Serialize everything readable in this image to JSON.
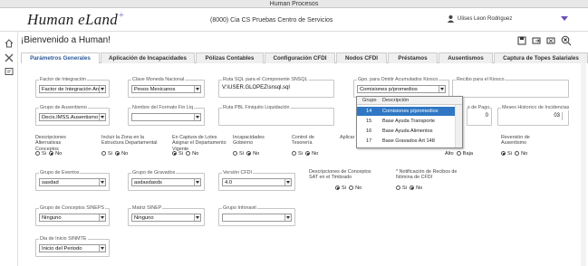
{
  "window_title": "Human Procesos",
  "header": {
    "logo_text": "Human eLand",
    "logo_mark": "+",
    "company": "(8000) Cia  CS  Pruebas Centro de Servicios",
    "user": "Ulises Leon Rodriguez"
  },
  "welcome": "¡Bienvenido a Human!",
  "tabs": [
    "Parámetros Generales",
    "Aplicación de Incapacidades",
    "Pólizas Contables",
    "Configuración CFDI",
    "Nodos CFDI",
    "Préstamos",
    "Ausentismos",
    "Captura de Topes Salariales"
  ],
  "fields": {
    "factor_integracion": {
      "label": "Factor de Integración",
      "value": "Factor de Integración Anu"
    },
    "clave_moneda": {
      "label": "Clave Moneda Nacional",
      "value": "Pesos Mexicanos"
    },
    "ruta_sql": {
      "label": "Ruta SQL para el Componente SNSQL",
      "value": "V:\\USER.GLOPEZ\\snsql.sql"
    },
    "grupo_omitir": {
      "label": "Gpo. para Omitir Acumulados Kiosco",
      "value": "Comisiones p/promedios"
    },
    "recibo_kiosco": {
      "label": "Recibo para el Kiosco",
      "value": ""
    },
    "grupo_ausentismo": {
      "label": "Grupo de Ausentismo",
      "value": "Decis.IMSS.Ausentismo"
    },
    "nombre_formato": {
      "label": "Nombre del Formato Fin Liq",
      "value": ""
    },
    "ruta_pbl": {
      "label": "Ruta PBL Finiquito Liquidación",
      "value": ""
    },
    "dias_pago": {
      "label": "s de Pago",
      "value": "0"
    },
    "meses_historico": {
      "label": "Meses Historico de Incidencias",
      "value": "03"
    },
    "grupo_eventos": {
      "label": "Grupo de Eventos",
      "value": "sasdad"
    },
    "grupo_gravados": {
      "label": "Grupo de Gravados",
      "value": "asdasdasds"
    },
    "version_cfdi": {
      "label": "Versión CFDI",
      "value": "4.0"
    },
    "grupo_sineps": {
      "label": "Grupo de Conceptos SINEPS",
      "value": "Ninguno"
    },
    "matriz_sinep": {
      "label": "Matriz SINEP",
      "value": "Ninguno"
    },
    "grupo_infonavit": {
      "label": "Grupo Infonavit",
      "value": ""
    },
    "dia_inicio_sinmte": {
      "label": "Dia de Inicio SINMTE",
      "value": "Inicio del Periodo"
    }
  },
  "radios": {
    "desc_alternativas": {
      "label": "Descripciones Alternativas Conceptos",
      "opts": [
        "Si",
        "No"
      ],
      "selected": "No"
    },
    "incluir_zona": {
      "label": "Incluir la Zona en la Estructura Departamental",
      "opts": [
        "Si",
        "No"
      ],
      "selected": "No"
    },
    "en_captura_lotes": {
      "label": "En Captura de Lotes Asignar el Departamento Vigente",
      "opts": [
        "Si",
        "No"
      ],
      "selected": "Si"
    },
    "incapacidades_gobierno": {
      "label": "Incapacidades Gobierno",
      "opts": [
        "Si",
        "No"
      ],
      "selected": "No"
    },
    "control_tesoreria": {
      "label": "Control de Tesorería",
      "opts": [
        "Si",
        "No"
      ],
      "selected": "No"
    },
    "aplicar_emple": {
      "label": "Aplicar Emple",
      "opts": [],
      "selected": ""
    },
    "ausentismo_alta_baja": {
      "label": "",
      "opts": [
        "Alto",
        "Baja"
      ],
      "selected": "Alto"
    },
    "reversion_ausentismo": {
      "label": "Reversión de Ausentismo",
      "opts": [
        "Si",
        "No"
      ],
      "selected": "Si"
    },
    "desc_sat_timbrado": {
      "label": "Descripciones de Conceptos SAT en el Timbrado",
      "opts": [
        "Si",
        "No"
      ],
      "selected": "Si"
    },
    "notificacion_recibos": {
      "label": "* Notificación de Recibos de Nómina de CFDI",
      "opts": [
        "Si",
        "No"
      ],
      "selected": "No"
    }
  },
  "dropdown_popup": {
    "headers": [
      "Grupo",
      "Descripción"
    ],
    "rows": [
      [
        "14",
        "Comisiones p/promedios"
      ],
      [
        "15",
        "Base Ayuda Transporte"
      ],
      [
        "16",
        "Base Ayuda Alimentos"
      ],
      [
        "17",
        "Base Gravados Art 148"
      ]
    ],
    "selected_index": 0
  },
  "colors": {
    "accent": "#6b4fb8",
    "selection": "#2f77c4",
    "tab_active_text": "#2a5a9a"
  }
}
